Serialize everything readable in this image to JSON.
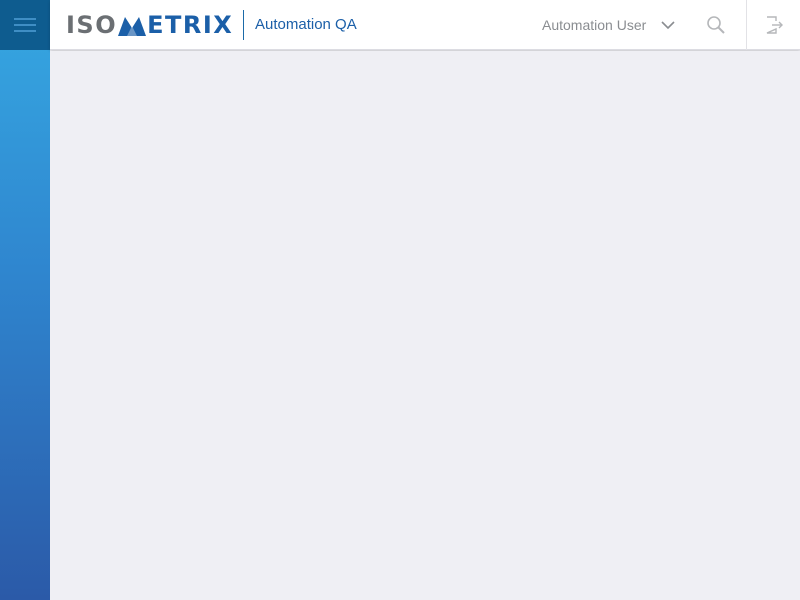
{
  "header": {
    "logo": {
      "part1": "ISO",
      "part2": "ETRIX"
    },
    "app_name": "Automation QA",
    "user_name": "Automation User",
    "icons": {
      "menu": "hamburger-menu-icon",
      "user_dropdown": "chevron-down-icon",
      "search": "search-icon",
      "logout": "logout-icon"
    }
  },
  "colors": {
    "brand_blue": "#1b5fa8",
    "menu_button": "#0e5c8f",
    "sidebar_top": "#36a8e2",
    "sidebar_bottom": "#2b5aa8",
    "background": "#efeff4"
  }
}
